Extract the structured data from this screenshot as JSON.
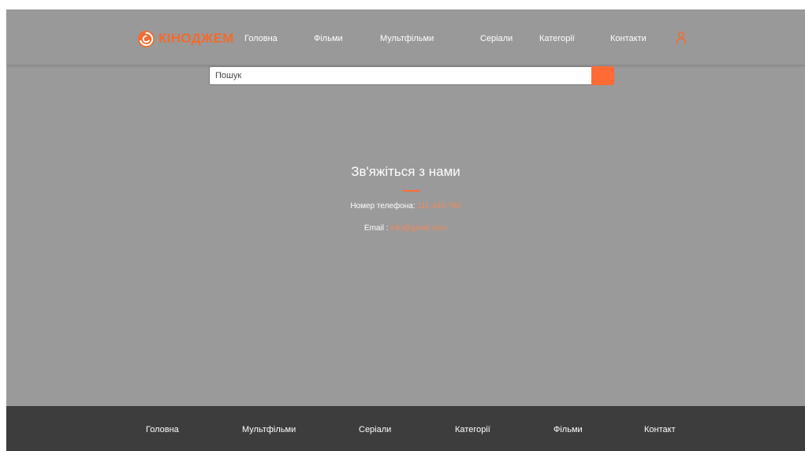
{
  "brand": {
    "logo_text": "КІНОДЖЕМ",
    "accent_color": "#f26b2d",
    "logo_icon": "swirl-logo-icon"
  },
  "nav": {
    "items": [
      "Головна",
      "Фільми",
      "Мультфільми",
      "Серіали",
      "Категорії",
      "Контакти"
    ],
    "user_icon": "user-icon"
  },
  "search": {
    "placeholder": "Пошук",
    "value": "",
    "button_icon": "search-icon"
  },
  "contact": {
    "title": "Зв'яжіться з нами",
    "phone_label": "Номер телефона:",
    "phone_value": "111-445-789",
    "email_label": "Email :",
    "email_value": "info@gmail.com"
  },
  "footer": {
    "items": [
      "Головна",
      "Мультфільми",
      "Серіали",
      "Категорії",
      "Фільми",
      "Контакт"
    ]
  }
}
